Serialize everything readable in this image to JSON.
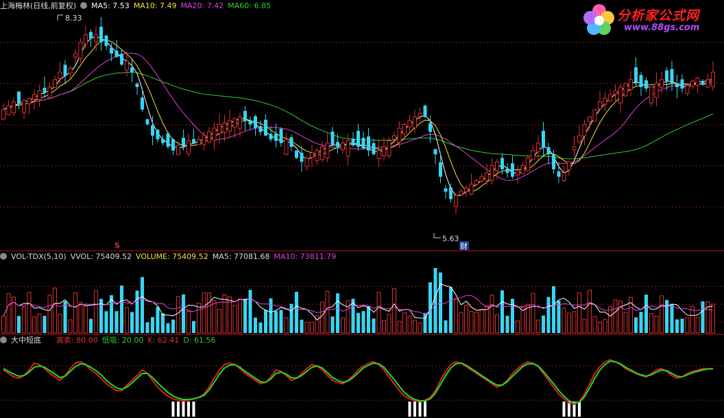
{
  "colors": {
    "background": "#000000",
    "up": "#e03030",
    "down": "#36d7f5",
    "ma5": "#ffffff",
    "ma10": "#f3e23c",
    "ma20": "#e040e0",
    "ma60": "#33cc33",
    "grid": "#8a1a1a",
    "separator": "#b01818"
  },
  "price_panel": {
    "title": "上海梅林(日线,前复权)",
    "ma5_label": "MA5: 7.53",
    "ma10_label": "MA10: 7.49",
    "ma20_label": "MA20: 7.42",
    "ma60_label": "MA60: 6.85",
    "high_label": "8.33",
    "low_label": "5.63",
    "event_marker_s": "S",
    "event_marker_cai": "财"
  },
  "volume_panel": {
    "title": "VOL-TDX(5,10)",
    "vvol_label": "VVOL: 75409.52",
    "volume_label": "VOLUME: 75409.52",
    "ma5_label": "MA5: 77081.68",
    "ma10_label": "MA10: 73811.79"
  },
  "indicator_panel": {
    "title": "大中短底",
    "high_sell_label": "高卖: 80.00",
    "low_buy_label": "低吸: 20.00",
    "k_label": "K: 62.41",
    "d_label": "D: 61.56"
  },
  "logo": {
    "title": "分析家公式网",
    "url": "www.88gs.com"
  },
  "chart_data": {
    "type": "candlestick",
    "ylim": [
      5.4,
      8.5
    ],
    "price_high": 8.33,
    "price_low": 5.63,
    "indicator_levels": {
      "high_sell": 80,
      "low_buy": 20
    },
    "last_values": {
      "ma5": 7.53,
      "ma10": 7.49,
      "ma20": 7.42,
      "ma60": 6.85,
      "vvol": 75409.52,
      "volume": 75409.52,
      "vol_ma5": 77081.68,
      "vol_ma10": 73811.79,
      "k": 62.41,
      "d": 61.56
    },
    "close": [
      7.2,
      7.25,
      7.3,
      7.28,
      7.32,
      7.35,
      7.4,
      7.45,
      7.42,
      7.5,
      7.6,
      7.7,
      7.65,
      7.75,
      7.95,
      8.1,
      8.2,
      8.15,
      8.2,
      8.1,
      8.05,
      7.95,
      7.9,
      7.8,
      7.85,
      7.7,
      7.5,
      7.2,
      7.0,
      6.85,
      6.8,
      6.75,
      6.7,
      6.65,
      6.72,
      6.7,
      6.78,
      6.75,
      6.8,
      6.85,
      6.9,
      6.95,
      7.0,
      7.02,
      7.05,
      7.08,
      7.1,
      7.05,
      7.0,
      6.95,
      6.9,
      6.85,
      6.8,
      6.78,
      6.75,
      6.8,
      6.7,
      6.55,
      6.5,
      6.55,
      6.62,
      6.65,
      6.7,
      6.75,
      6.72,
      6.7,
      6.75,
      6.78,
      6.72,
      6.7,
      6.68,
      6.65,
      6.6,
      6.65,
      6.7,
      6.78,
      6.85,
      6.95,
      7.0,
      7.05,
      7.1,
      7.15,
      7.1,
      6.9,
      6.6,
      6.3,
      6.1,
      6.0,
      6.05,
      6.1,
      6.15,
      6.2,
      6.25,
      6.3,
      6.35,
      6.45,
      6.5,
      6.4,
      6.35,
      6.3,
      6.38,
      6.45,
      6.55,
      6.65,
      6.75,
      6.7,
      6.6,
      6.4,
      6.3,
      6.35,
      6.5,
      6.7,
      6.85,
      7.0,
      7.1,
      7.2,
      7.3,
      7.35,
      7.4,
      7.45,
      7.5,
      7.55,
      7.6,
      7.55,
      7.5,
      7.48,
      7.5,
      7.55,
      7.6,
      7.58,
      7.55,
      7.5,
      7.48,
      7.52,
      7.58,
      7.62,
      7.53,
      7.6,
      7.7
    ],
    "k": [
      60,
      55,
      50,
      48,
      52,
      60,
      70,
      68,
      62,
      55,
      50,
      45,
      52,
      62,
      70,
      72,
      68,
      60,
      55,
      48,
      40,
      35,
      30,
      30,
      38,
      45,
      52,
      60,
      55,
      45,
      35,
      28,
      22,
      18,
      16,
      15,
      16,
      18,
      20,
      25,
      35,
      48,
      60,
      68,
      70,
      68,
      62,
      55,
      50,
      45,
      40,
      42,
      50,
      60,
      58,
      52,
      45,
      48,
      55,
      62,
      68,
      66,
      60,
      52,
      45,
      42,
      40,
      45,
      52,
      60,
      66,
      70,
      72,
      68,
      60,
      50,
      40,
      30,
      22,
      18,
      15,
      14,
      16,
      20,
      30,
      45,
      58,
      68,
      72,
      70,
      65,
      60,
      55,
      50,
      45,
      40,
      35,
      38,
      45,
      55,
      62,
      68,
      72,
      70,
      65,
      55,
      45,
      35,
      25,
      18,
      12,
      10,
      14,
      25,
      40,
      55,
      65,
      72,
      75,
      72,
      68,
      62,
      58,
      55,
      52,
      50,
      55,
      60,
      62,
      58,
      52,
      48,
      50,
      55,
      58,
      60,
      62,
      61.56,
      62.41
    ],
    "d": [
      62,
      58,
      54,
      51,
      52,
      57,
      64,
      66,
      64,
      59,
      54,
      49,
      51,
      58,
      65,
      69,
      68,
      64,
      59,
      53,
      45,
      39,
      34,
      32,
      35,
      41,
      48,
      55,
      55,
      49,
      41,
      34,
      27,
      22,
      19,
      17,
      17,
      18,
      20,
      23,
      31,
      42,
      54,
      63,
      67,
      68,
      64,
      58,
      53,
      48,
      43,
      42,
      47,
      55,
      57,
      54,
      49,
      48,
      52,
      58,
      64,
      66,
      63,
      56,
      49,
      45,
      42,
      44,
      49,
      56,
      63,
      67,
      70,
      69,
      64,
      55,
      46,
      36,
      27,
      21,
      17,
      15,
      15,
      18,
      26,
      39,
      52,
      63,
      69,
      70,
      67,
      62,
      57,
      52,
      47,
      42,
      38,
      38,
      43,
      51,
      58,
      65,
      69,
      69,
      66,
      58,
      49,
      40,
      30,
      22,
      15,
      12,
      13,
      21,
      34,
      48,
      60,
      68,
      73,
      72,
      69,
      64,
      60,
      56,
      53,
      51,
      53,
      57,
      60,
      59,
      55,
      51,
      50,
      53,
      56,
      58,
      60,
      61.56,
      61.56
    ]
  }
}
